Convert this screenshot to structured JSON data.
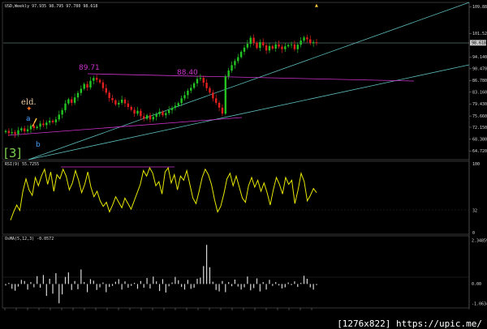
{
  "chart_data": [
    {
      "type": "candlestick",
      "title": "USD,Weekly",
      "header_values": "97.935 98.795 97.780 98.618",
      "y_ticks": [
        "109.880",
        "101.520",
        "98.618",
        "94.140",
        "90.470",
        "86.780",
        "83.160",
        "79.430",
        "75.660",
        "72.150",
        "68.380",
        "64.720"
      ],
      "ylim": [
        62.5,
        110.5
      ],
      "grid": false,
      "candles_close": [
        71.0,
        70.3,
        70.6,
        70.0,
        71.2,
        71.8,
        70.9,
        71.5,
        72.6,
        71.9,
        72.3,
        73.3,
        72.8,
        73.6,
        74.2,
        73.7,
        74.6,
        76.1,
        77.5,
        79.6,
        80.9,
        79.8,
        81.5,
        82.9,
        84.2,
        85.7,
        84.6,
        86.7,
        87.6,
        87.0,
        86.2,
        84.4,
        83.0,
        81.3,
        80.6,
        79.3,
        79.8,
        80.8,
        79.6,
        78.5,
        77.6,
        76.4,
        77.3,
        75.6,
        74.8,
        75.9,
        74.6,
        75.4,
        76.2,
        77.0,
        75.9,
        76.6,
        77.5,
        78.2,
        78.9,
        79.7,
        81.2,
        82.2,
        83.6,
        84.5,
        85.9,
        87.3,
        87.6,
        86.1,
        84.4,
        83.0,
        81.2,
        79.8,
        78.3,
        76.4,
        88.1,
        89.9,
        91.6,
        92.9,
        94.1,
        95.8,
        97.1,
        98.3,
        100.2,
        98.6,
        97.0,
        98.8,
        97.8,
        96.2,
        97.6,
        96.8,
        98.1,
        97.4,
        96.6,
        97.5,
        97.9,
        98.1,
        96.6,
        98.0,
        99.3,
        100.3,
        99.7,
        98.5,
        98.8,
        98.6
      ],
      "annotations": [
        "89.71",
        "88.40",
        "eld.",
        "a",
        "b",
        "[3]"
      ],
      "colors": {
        "up": "#22c322",
        "down": "#e02020",
        "channel": "#5fbfbf",
        "trend": "#cc33cc",
        "price_line": "#88aaaa"
      }
    },
    {
      "type": "line",
      "title": "RSI(9) 55.7255",
      "y_ticks": [
        "100",
        "32",
        "0"
      ],
      "ylim": [
        0,
        100
      ],
      "values": [
        18,
        30,
        40,
        32,
        60,
        78,
        62,
        54,
        80,
        68,
        82,
        92,
        70,
        88,
        60,
        84,
        78,
        92,
        82,
        62,
        72,
        90,
        76,
        58,
        70,
        88,
        66,
        52,
        60,
        46,
        38,
        44,
        30,
        40,
        52,
        44,
        36,
        50,
        42,
        34,
        46,
        58,
        70,
        90,
        82,
        94,
        86,
        68,
        74,
        56,
        88,
        94,
        72,
        84,
        62,
        82,
        76,
        90,
        70,
        50,
        42,
        60,
        80,
        92,
        84,
        70,
        48,
        30,
        38,
        56,
        78,
        86,
        68,
        82,
        66,
        50,
        44,
        68,
        80,
        66,
        76,
        60,
        72,
        58,
        40,
        62,
        80,
        70,
        56,
        80,
        70,
        76,
        42,
        62,
        86,
        74,
        46,
        54,
        64,
        58
      ]
    },
    {
      "type": "bar",
      "title": "OsMA(5,12,3) -0.0572",
      "y_ticks": [
        "2.34859",
        "0.00",
        "-1.06342"
      ],
      "ylim": [
        -1.2,
        2.5
      ],
      "values": [
        -0.08,
        0.06,
        -0.26,
        -0.36,
        -0.14,
        0.22,
        0.16,
        -0.3,
        0.1,
        -0.18,
        0.42,
        -0.2,
        0.48,
        -0.64,
        0.28,
        -0.52,
        0.58,
        -1.04,
        -0.56,
        0.38,
        0.62,
        -0.32,
        0.16,
        -0.28,
        0.78,
        0.1,
        -0.44,
        0.26,
        0.18,
        -0.32,
        -0.18,
        0.08,
        -0.44,
        -0.16,
        -0.1,
        0.12,
        0.26,
        -0.3,
        0.14,
        -0.2,
        -0.1,
        0.06,
        -0.26,
        0.16,
        -0.2,
        0.32,
        -0.24,
        0.4,
        0.14,
        -0.38,
        0.26,
        -0.46,
        -0.12,
        0.08,
        0.38,
        0.2,
        -0.16,
        -0.3,
        0.22,
        -0.26,
        -0.2,
        0.28,
        0.34,
        0.96,
        2.1,
        0.9,
        0.12,
        -0.32,
        -0.4,
        0.16,
        -0.44,
        0.1,
        -0.12,
        0.24,
        -0.14,
        -0.3,
        -0.18,
        0.4,
        -0.34,
        -0.22,
        0.3,
        -0.4,
        0.1,
        -0.3,
        0.22,
        -0.1,
        0.1,
        -0.08,
        -0.24,
        -0.18,
        0.08,
        -0.06,
        0.14,
        -0.16,
        0.06,
        0.44,
        0.28,
        -0.18,
        -0.3,
        -0.06
      ]
    }
  ],
  "watermark": "[1276x822] https://upic.me/"
}
